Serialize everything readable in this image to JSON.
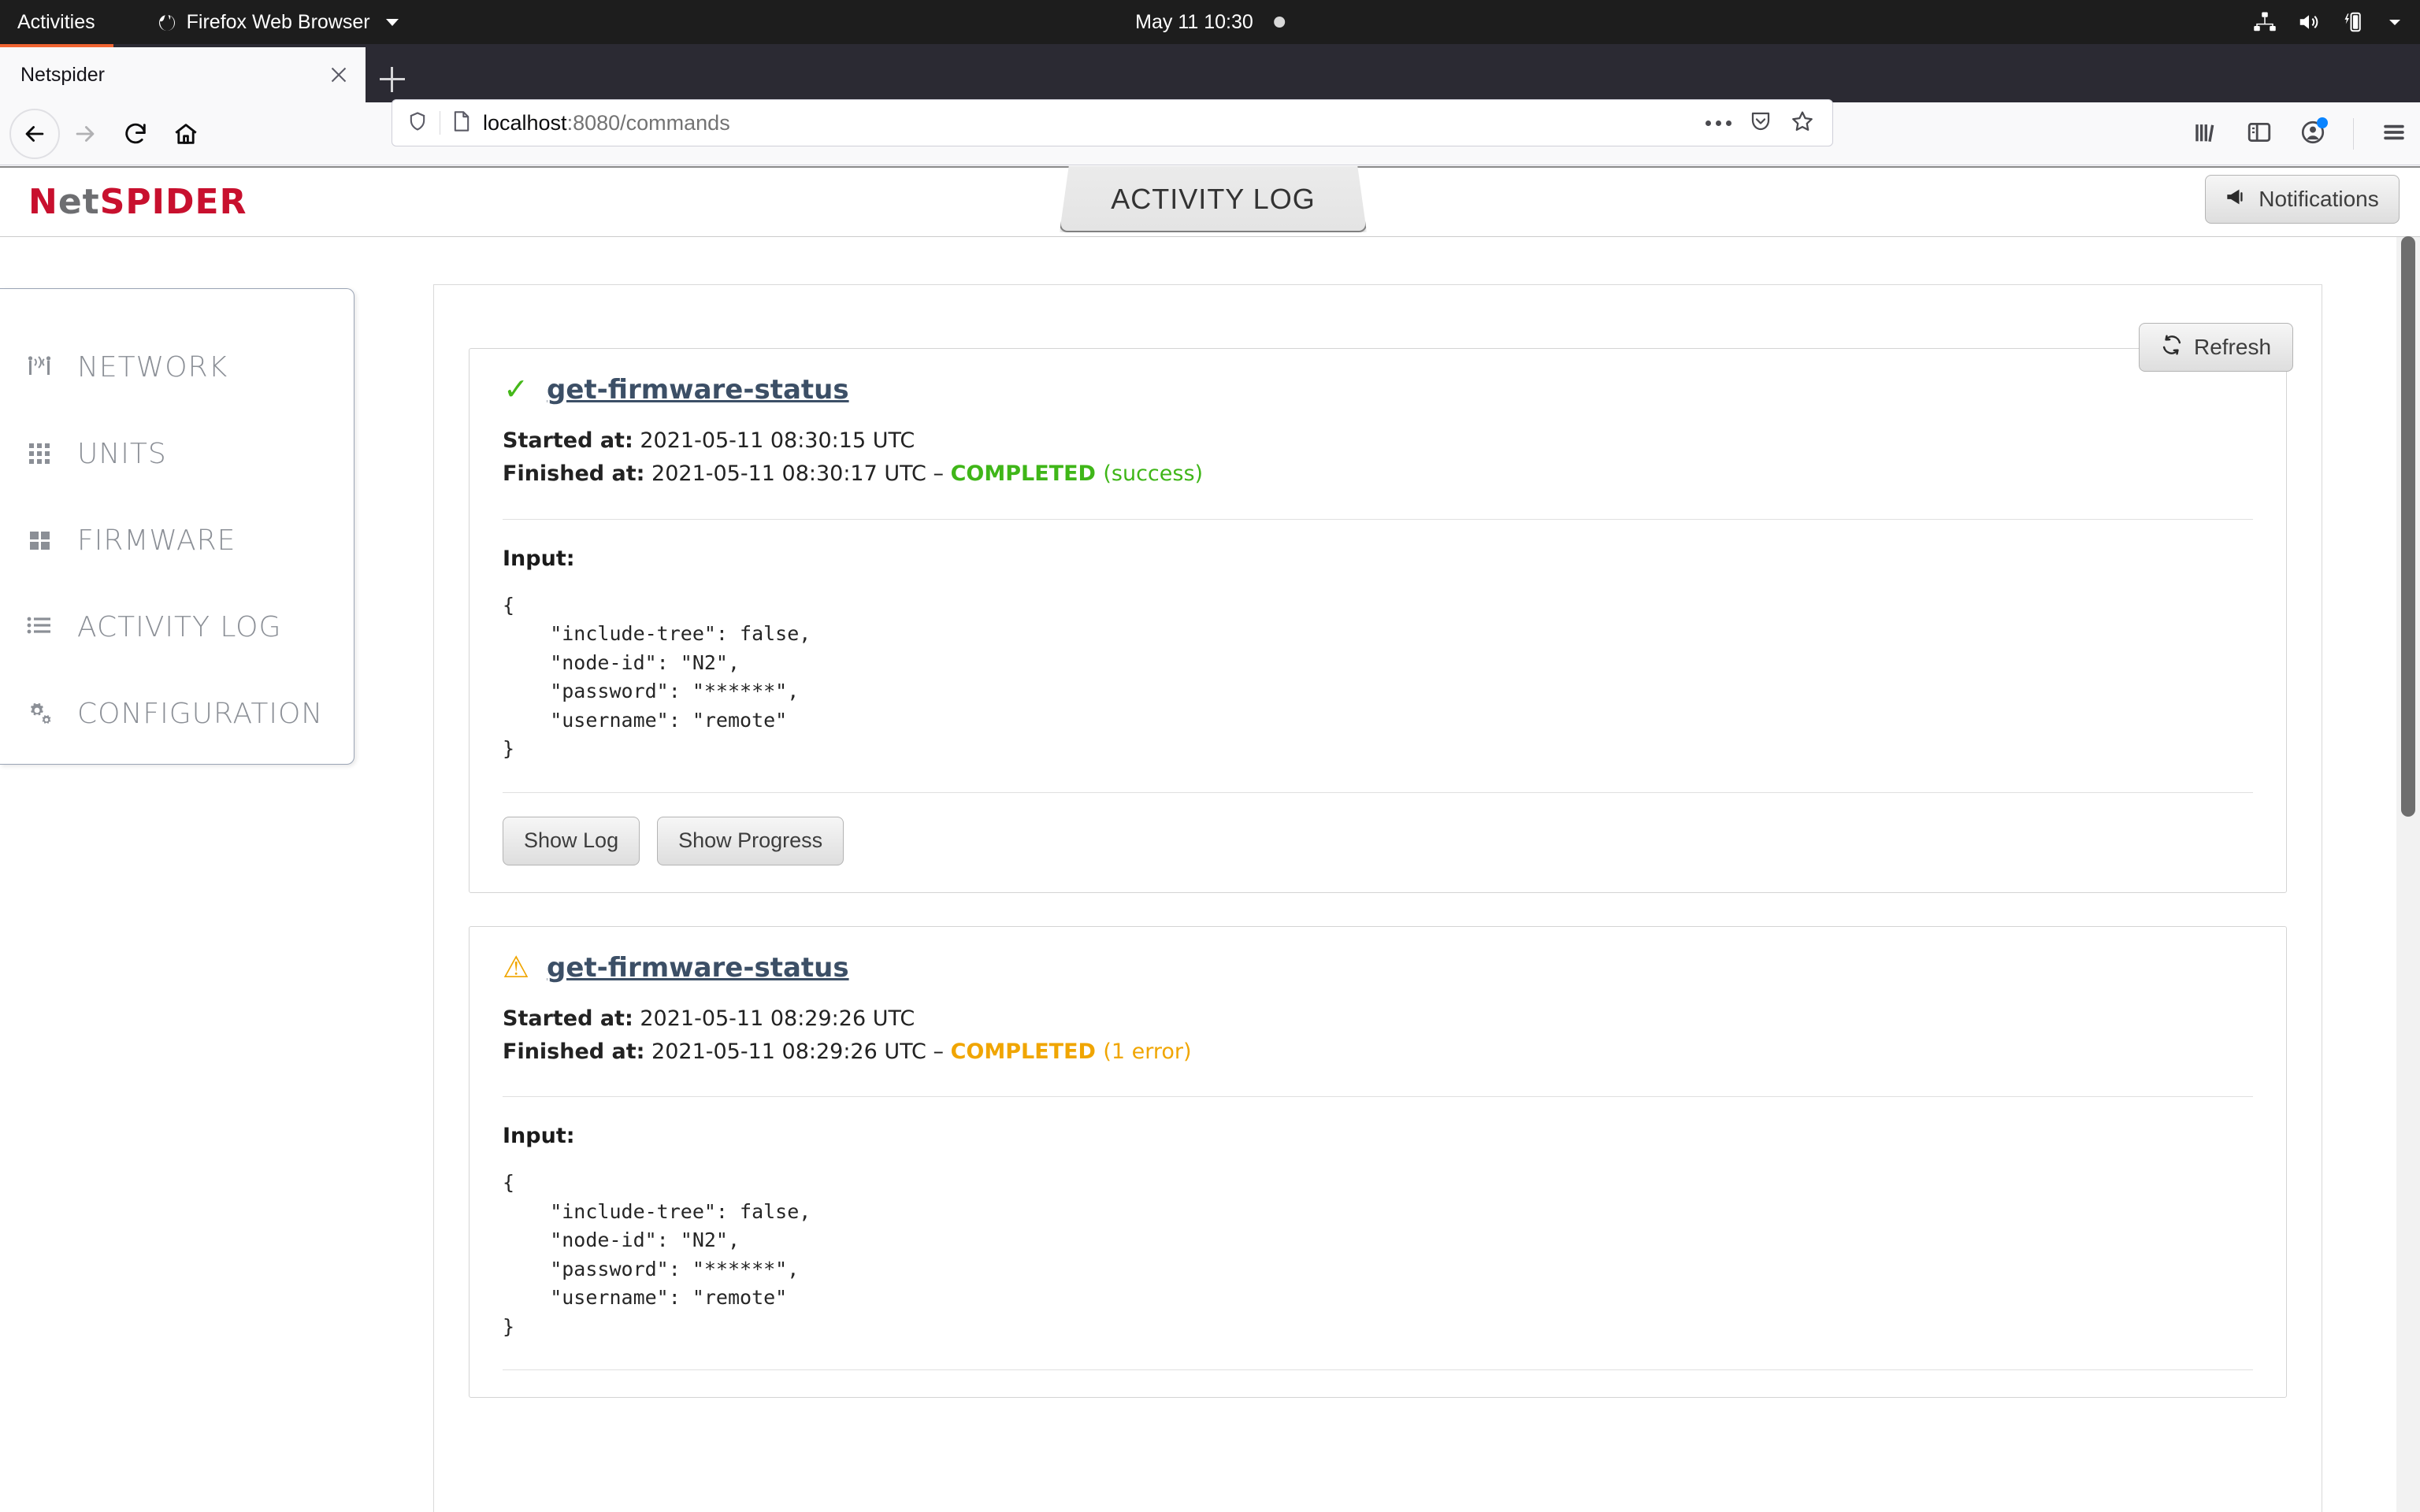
{
  "os_bar": {
    "activities": "Activities",
    "app_menu": "Firefox Web Browser",
    "clock": "May 11  10:30",
    "tray_icons": [
      "network-wired-icon",
      "volume-icon",
      "battery-charging-icon",
      "dropdown-arrow-icon"
    ]
  },
  "browser": {
    "tab_title": "Netspider",
    "new_tab_label": "+",
    "url_host": "localhost",
    "url_rest": ":8080/commands",
    "nav_icons": [
      "back-icon",
      "forward-icon",
      "reload-icon",
      "home-icon"
    ],
    "url_actions": [
      "page-actions-icon",
      "pocket-icon",
      "bookmark-star-icon"
    ],
    "toolbar_icons": [
      "library-icon",
      "sidebar-icon",
      "account-icon",
      "app-menu-icon"
    ]
  },
  "app": {
    "brand_first": "N",
    "brand_mid": "et",
    "brand_last": "SPIDER",
    "tab_label": "ACTIVITY LOG",
    "notifications_label": "Notifications",
    "refresh_label": "Refresh"
  },
  "sidebar": {
    "items": [
      {
        "label": "NETWORK",
        "icon": "antenna-icon"
      },
      {
        "label": "UNITS",
        "icon": "grid-3x3-icon"
      },
      {
        "label": "FIRMWARE",
        "icon": "grid-2x2-icon"
      },
      {
        "label": "ACTIVITY LOG",
        "icon": "list-icon"
      },
      {
        "label": "CONFIGURATION",
        "icon": "gears-icon"
      }
    ]
  },
  "activity_log": {
    "entries": [
      {
        "status_icon": "check-icon",
        "status_kind": "ok",
        "status_glyph": "✓",
        "name": "get-firmware-status",
        "started_label": "Started at:",
        "started_value": "2021-05-11 08:30:15 UTC",
        "finished_label": "Finished at:",
        "finished_value": "2021-05-11 08:30:17 UTC",
        "separator": "–",
        "state": "COMPLETED",
        "state_detail": "(success)",
        "input_label": "Input:",
        "input_json": "{\n    \"include-tree\": false,\n    \"node-id\": \"N2\",\n    \"password\": \"******\",\n    \"username\": \"remote\"\n}",
        "show_log_label": "Show Log",
        "show_progress_label": "Show Progress"
      },
      {
        "status_icon": "warning-triangle-icon",
        "status_kind": "warn",
        "status_glyph": "⚠",
        "name": "get-firmware-status",
        "started_label": "Started at:",
        "started_value": "2021-05-11 08:29:26 UTC",
        "finished_label": "Finished at:",
        "finished_value": "2021-05-11 08:29:26 UTC",
        "separator": "–",
        "state": "COMPLETED",
        "state_detail": "(1 error)",
        "input_label": "Input:",
        "input_json": "{\n    \"include-tree\": false,\n    \"node-id\": \"N2\",\n    \"password\": \"******\",\n    \"username\": \"remote\"\n}"
      }
    ]
  },
  "colors": {
    "brand_red": "#c8102e",
    "brand_gray": "#6d6e71",
    "success_green": "#3fb618",
    "warning_orange": "#f0a500",
    "link_blue": "#3c4f66",
    "firefox_orange": "#f06432"
  }
}
